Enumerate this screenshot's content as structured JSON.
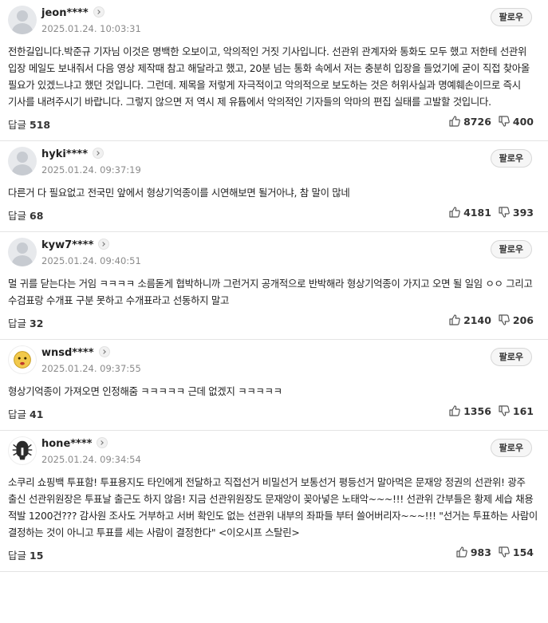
{
  "follow_label": "팔로우",
  "reply_label": "답글",
  "comments": [
    {
      "nick": "jeon****",
      "date": "2025.01.24. 10:03:31",
      "avatar": "default-user-icon",
      "text": "전한길입니다.박준규 기자님 이것은 명백한 오보이고, 악의적인 거짓 기사입니다. 선관위 관계자와 통화도 모두 했고 저한테 선관위 입장 메일도 보내줘서 다음 영상 제작때 참고 해달라고 했고, 20분 넘는 통화 속에서 저는 충분히 입장을 들었기에 굳이 직접 찾아올 필요가 있겠느냐고 했던 것입니다. 그런데. 제목을 저렇게 자극적이고 악의적으로 보도하는 것은 허위사실과 명예훼손이므로 즉시 기사를 내려주시기 바랍니다. 그렇지 않으면 저 역시 제 유튭에서 악의적인 기자들의 악마의 편집 실태를 고발할 것입니다.",
      "replies": "518",
      "likes": "8726",
      "dislikes": "400"
    },
    {
      "nick": "hyki****",
      "date": "2025.01.24. 09:37:19",
      "avatar": "default-user-icon",
      "text": "다른거 다 필요없고 전국민 앞에서 형상기억종이를 시연해보면 될거아냐, 참 말이 많네",
      "replies": "68",
      "likes": "4181",
      "dislikes": "393"
    },
    {
      "nick": "kyw7****",
      "date": "2025.01.24. 09:40:51",
      "avatar": "default-user-icon",
      "text": "멀 귀를 닫는다는 거임 ㅋㅋㅋㅋ 소름돋게 협박하니까 그런거지 공개적으로 반박해라 형상기억종이 가지고 오면 될 일임 ㅇㅇ 그리고 수검표랑 수개표 구분 못하고 수개표라고 선동하지 말고",
      "replies": "32",
      "likes": "2140",
      "dislikes": "206"
    },
    {
      "nick": "wnsd****",
      "date": "2025.01.24. 09:37:55",
      "avatar": "emoji-face-icon",
      "text": "형상기억종이 가져오면 인정해줌 ㅋㅋㅋㅋㅋ 근데 없겠지 ㅋㅋㅋㅋㅋ",
      "replies": "41",
      "likes": "1356",
      "dislikes": "161"
    },
    {
      "nick": "hone****",
      "date": "2025.01.24. 09:34:54",
      "avatar": "spartan-helmet-icon",
      "text": "소쿠리 쇼핑백 투표함! 투표용지도 타인에게 전달하고 직접선거 비밀선거 보통선거 평등선거 말아먹은 문재앙 정권의 선관위! 광주 출신 선관위원장은 투표날 출근도 하지 않음! 지금 선관위원장도 문재앙이 꽂아넣은 노태악~~~!!! 선관위 간부들은 황제 세습 채용 적발 1200건??? 감사원 조사도 거부하고 서버 확인도 없는 선관위 내부의 좌파들 부터 쓸어버리자~~~!!! \"선거는 투표하는 사람이 결정하는 것이 아니고 투표를 세는 사람이 결정한다\" <이오시프 스탈린>",
      "replies": "15",
      "likes": "983",
      "dislikes": "154"
    }
  ]
}
